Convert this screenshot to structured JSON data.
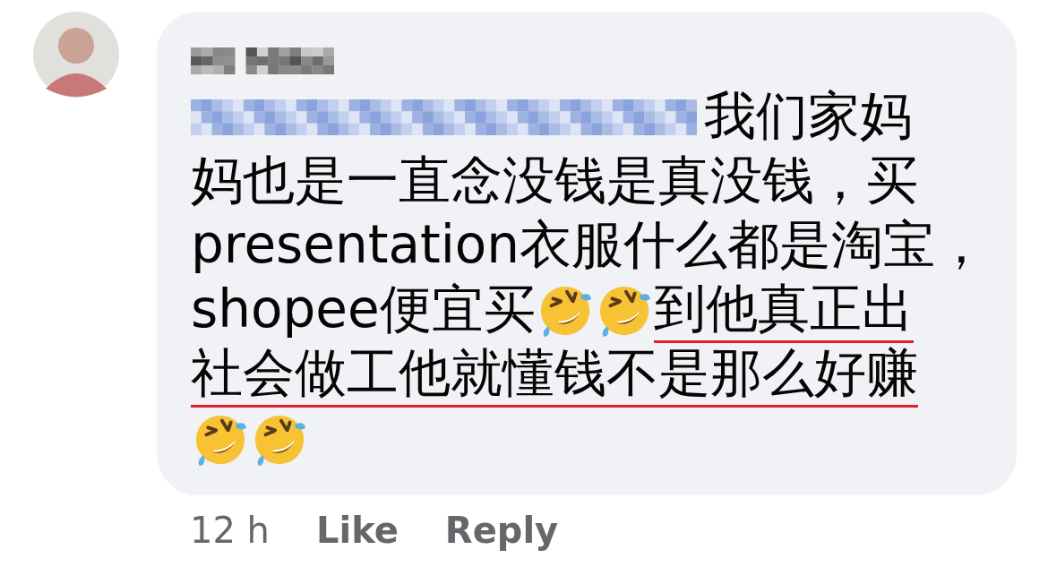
{
  "comment": {
    "lines": [
      [
        {
          "kind": "mention"
        },
        {
          "kind": "text",
          "text": " 我们家妈",
          "underlined": false
        }
      ],
      [
        {
          "kind": "text",
          "text": "妈也是一直念没钱是真没钱，买",
          "underlined": false
        }
      ],
      [
        {
          "kind": "text",
          "text": "presentation衣服什么都是淘宝，",
          "underlined": false
        }
      ],
      [
        {
          "kind": "text",
          "text": "shopee便宜买",
          "underlined": false
        },
        {
          "kind": "emoji"
        },
        {
          "kind": "emoji"
        },
        {
          "kind": "text",
          "text": "到他真正出",
          "underlined": true
        }
      ],
      [
        {
          "kind": "text",
          "text": "社会做工他就懂钱不是那么好赚",
          "underlined": true
        }
      ],
      [
        {
          "kind": "emoji"
        },
        {
          "kind": "emoji"
        }
      ]
    ],
    "time": "12 h",
    "actions": [
      "Like",
      "Reply"
    ]
  }
}
